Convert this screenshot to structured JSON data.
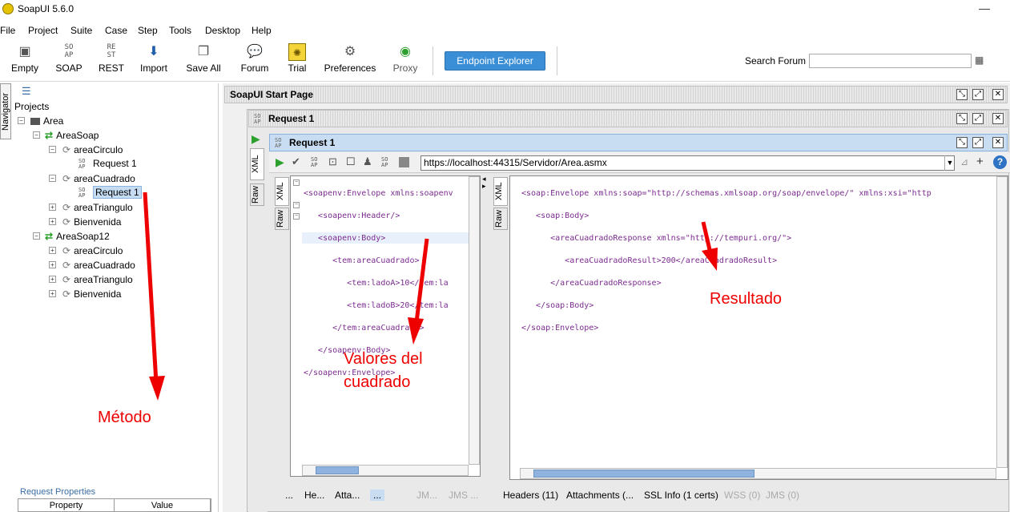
{
  "app": {
    "title": "SoapUI 5.6.0"
  },
  "menu": [
    "File",
    "Project",
    "Suite",
    "Case",
    "Step",
    "Tools",
    "Desktop",
    "Help"
  ],
  "toolbar": {
    "buttons": [
      {
        "label": "Empty",
        "icon": "empty-project-icon"
      },
      {
        "label": "SOAP",
        "icon": "soap-icon"
      },
      {
        "label": "REST",
        "icon": "rest-icon"
      },
      {
        "label": "Import",
        "icon": "import-icon"
      },
      {
        "label": "Save All",
        "icon": "save-all-icon"
      },
      {
        "label": "Forum",
        "icon": "forum-icon"
      },
      {
        "label": "Trial",
        "icon": "trial-icon"
      },
      {
        "label": "Preferences",
        "icon": "gear-icon"
      },
      {
        "label": "Proxy",
        "icon": "proxy-icon"
      }
    ],
    "endpoint_explorer": "Endpoint Explorer",
    "search_label": "Search Forum",
    "search_value": ""
  },
  "navigator": {
    "tab_label": "Navigator",
    "projects_label": "Projects",
    "tree": {
      "root": "Area",
      "iface1": "AreaSoap",
      "iface1_ops": [
        "areaCirculo",
        "areaCuadrado",
        "areaTriangulo",
        "Bienvenida"
      ],
      "req_circulo": "Request 1",
      "req_cuadrado": "Request 1",
      "iface2": "AreaSoap12",
      "iface2_ops": [
        "areaCirculo",
        "areaCuadrado",
        "areaTriangulo",
        "Bienvenida"
      ]
    },
    "request_properties": "Request Properties",
    "props_columns": [
      "Property",
      "Value"
    ]
  },
  "workspace": {
    "start_page_title": "SoapUI Start Page",
    "request_outer_title": "Request 1",
    "request_inner_title": "Request 1",
    "soap_badge": "SO AP",
    "endpoint_url": "https://localhost:44315/Servidor/Area.asmx",
    "side_tabs": {
      "xml": "XML",
      "raw": "Raw"
    },
    "request_xml": [
      "<soapenv:Envelope xmlns:soapenv",
      "   <soapenv:Header/>",
      "   <soapenv:Body>",
      "      <tem:areaCuadrado>",
      "         <tem:ladoA>10</tem:la",
      "         <tem:ladoB>20</tem:la",
      "      </tem:areaCuadrado>",
      "   </soapenv:Body>",
      "</soapenv:Envelope>"
    ],
    "response_xml": [
      "<soap:Envelope xmlns:soap=\"http://schemas.xmlsoap.org/soap/envelope/\" xmlns:xsi=\"http",
      "   <soap:Body>",
      "      <areaCuadradoResponse xmlns=\"http://tempuri.org/\">",
      "         <areaCuadradoResult>200</areaCuadradoResult>",
      "      </areaCuadradoResponse>",
      "   </soap:Body>",
      "</soap:Envelope>"
    ],
    "request_bottom_tabs": [
      "...",
      "He...",
      "Atta...",
      "...",
      "JM...",
      "JMS ..."
    ],
    "response_bottom_tabs": [
      "Headers (11)",
      "Attachments (...",
      "SSL Info (1 certs)",
      "WSS (0)",
      "JMS (0)"
    ]
  },
  "annotations": {
    "metodo": "Método",
    "valores_line1": "Valores del",
    "valores_line2": "cuadrado",
    "resultado": "Resultado"
  },
  "colors": {
    "annotation": "#e00000",
    "endpoint_button": "#3b8fd6",
    "selection": "#c5dcf3"
  }
}
